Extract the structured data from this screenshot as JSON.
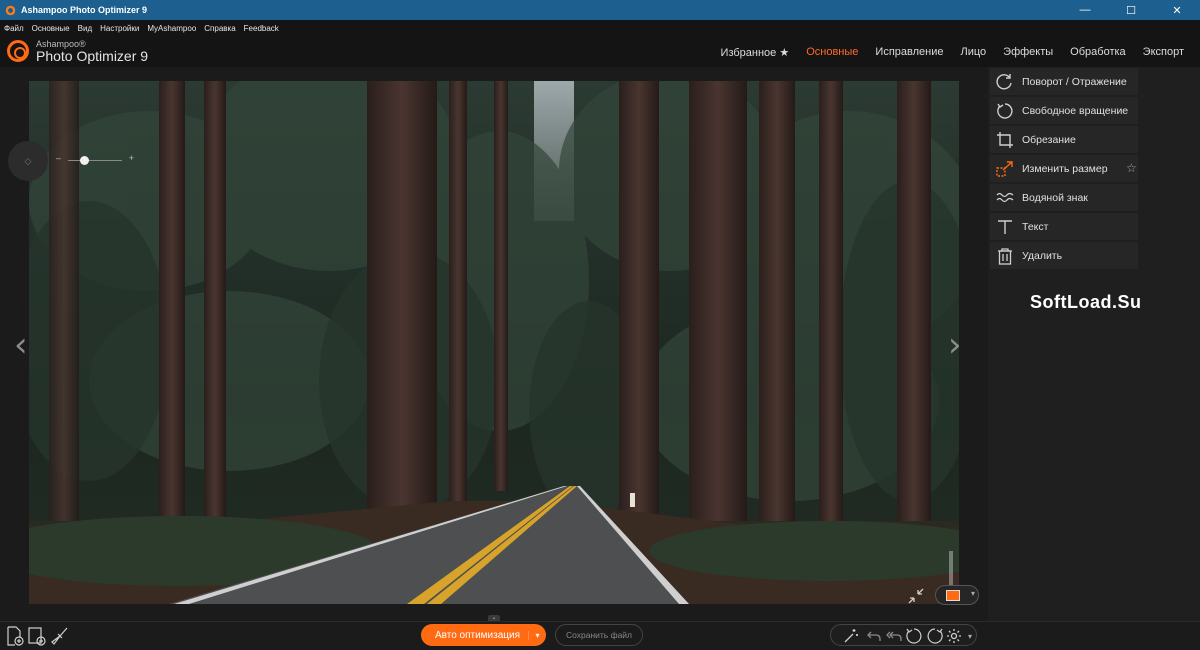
{
  "window": {
    "title": "Ashampoo Photo Optimizer 9",
    "minimize": "—",
    "maximize": "☐",
    "close": "✕"
  },
  "menu": [
    "Файл",
    "Основные",
    "Вид",
    "Настройки",
    "MyAshampoo",
    "Справка",
    "Feedback"
  ],
  "brand": {
    "small": "Ashampoo®",
    "big": "Photo Optimizer 9",
    "accent": "#ff6a13"
  },
  "nav": {
    "favorites": "Избранное ★",
    "basic": "Основные",
    "correction": "Исправление",
    "face": "Лицо",
    "effects": "Эффекты",
    "processing": "Обработка",
    "export": "Экспорт"
  },
  "zoom": {
    "minus": "–",
    "plus": "+",
    "level": 0.3
  },
  "viewer": {
    "prev": "‹",
    "next": "›",
    "collapse": "⌄",
    "toggle_caret": "▾"
  },
  "tools": [
    {
      "label": "Поворот / Отражение"
    },
    {
      "label": "Свободное вращение"
    },
    {
      "label": "Обрезание"
    },
    {
      "label": "Изменить размер",
      "star": "☆"
    },
    {
      "label": "Водяной знак"
    },
    {
      "label": "Текст"
    },
    {
      "label": "Удалить"
    }
  ],
  "watermark": "SoftLoad.Su",
  "bottom": {
    "auto_optimize": "Авто оптимизация",
    "auto_caret": "▾",
    "save_file": "Сохранить файл",
    "rotate_left": "90°",
    "rotate_right": "90°"
  }
}
